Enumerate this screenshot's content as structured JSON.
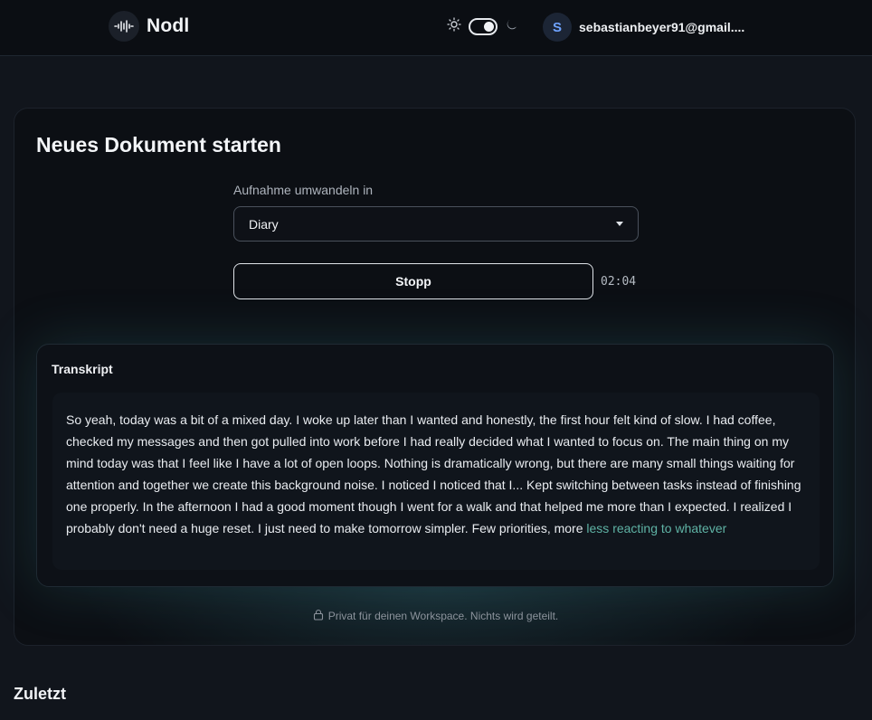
{
  "header": {
    "brand": "Nodl",
    "user_initial": "S",
    "user_email": "sebastianbeyer91@gmail...."
  },
  "card": {
    "title": "Neues Dokument starten",
    "field_label": "Aufnahme umwandeln in",
    "select_value": "Diary",
    "stop_label": "Stopp",
    "timer": "02:04",
    "transcript_title": "Transkript",
    "transcript_text": "So yeah, today was a bit of a mixed day. I woke up later than I wanted and honestly, the first hour felt kind of slow. I had coffee, checked my messages and then got pulled into work before I had really decided what I wanted to focus on. The main thing on my mind today was that I feel like I have a lot of open loops. Nothing is dramatically wrong, but there are many small things waiting for attention and together we create this background noise. I noticed I noticed that I... Kept switching between tasks instead of finishing one properly. In the afternoon I had a good moment though I went for a walk and that helped me more than I expected. I realized I probably don't need a huge reset. I just need to make tomorrow simpler. Few priorities, more ",
    "transcript_live": "less reacting to whatever",
    "privacy": "Privat für deinen Workspace. Nichts wird geteilt."
  },
  "recent": {
    "title": "Zuletzt"
  },
  "colors": {
    "accent_live": "#5fb3a5",
    "avatar_text": "#6fa3ff"
  }
}
